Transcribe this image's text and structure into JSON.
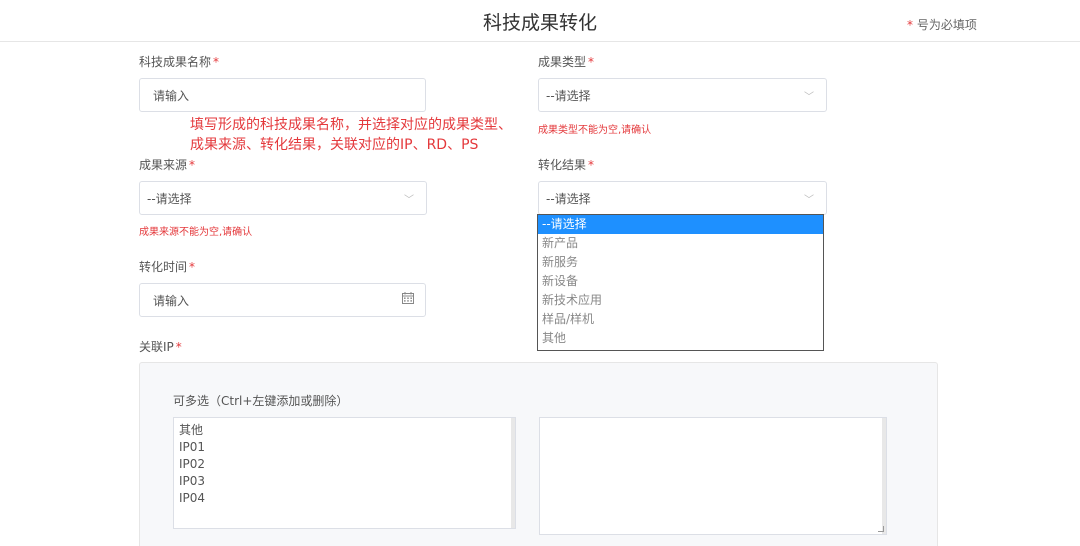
{
  "header": {
    "title": "科技成果转化",
    "required_star": "*",
    "required_note": "号为必填项"
  },
  "fields": {
    "name": {
      "label": "科技成果名称",
      "star": "*",
      "placeholder": "请输入"
    },
    "type": {
      "label": "成果类型",
      "star": "*",
      "value": "--请选择",
      "error": "成果类型不能为空,请确认"
    },
    "source": {
      "label": "成果来源",
      "star": "*",
      "value": "--请选择",
      "error": "成果来源不能为空,请确认"
    },
    "result": {
      "label": "转化结果",
      "star": "*",
      "value": "--请选择",
      "options": [
        "--请选择",
        "新产品",
        "新服务",
        "新设备",
        "新技术应用",
        "样品/样机",
        "其他"
      ]
    },
    "time": {
      "label": "转化时间",
      "star": "*",
      "placeholder": "请输入"
    },
    "ip": {
      "label": "关联IP",
      "star": "*",
      "multi_label": "可多选（Ctrl+左键添加或删除）",
      "options": [
        "其他",
        "IP01",
        "IP02",
        "IP03",
        "IP04"
      ]
    }
  },
  "annotation": {
    "line1": "填写形成的科技成果名称，并选择对应的成果类型、",
    "line2": "成果来源、转化结果，关联对应的IP、RD、PS"
  },
  "icons": {
    "chevron": "chevron-down-icon",
    "calendar": "calendar-icon"
  },
  "colors": {
    "required": "#e4393c",
    "selected_option": "#1e90ff"
  }
}
